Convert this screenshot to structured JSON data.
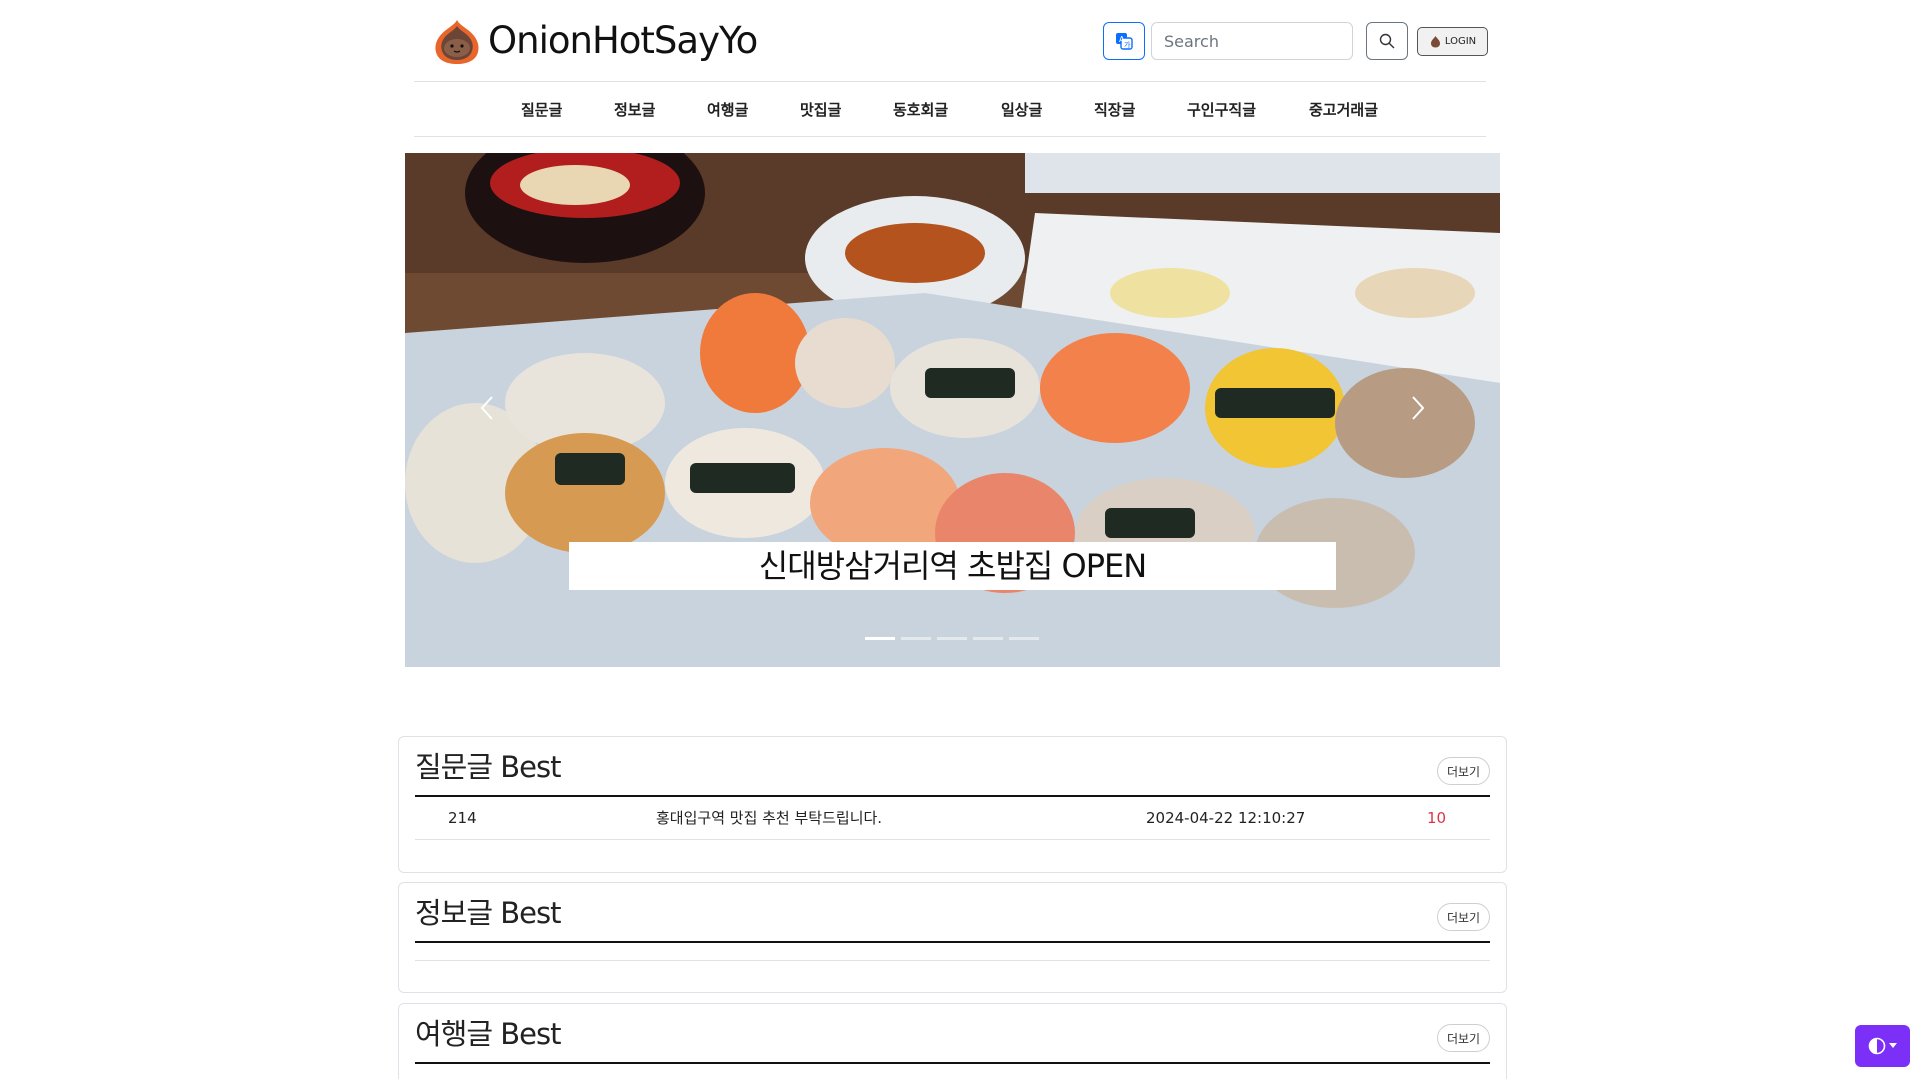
{
  "header": {
    "logo_text": "OnionHotSayYo",
    "search_placeholder": "Search",
    "login_label": "LOGIN"
  },
  "nav": {
    "items": [
      "질문글",
      "정보글",
      "여행글",
      "맛집글",
      "동호회글",
      "일상글",
      "직장글",
      "구인구직글",
      "중고거래글"
    ]
  },
  "carousel": {
    "caption": "신대방삼거리역 초밥집 OPEN",
    "slide_count": 5,
    "active_index": 0
  },
  "sections": [
    {
      "title": "질문글 Best",
      "more_label": "더보기",
      "rows": [
        {
          "id": "214",
          "subject": "홍대입구역 맛집 추천 부탁드립니다.",
          "date": "2024-04-22 12:10:27",
          "count": "10"
        }
      ]
    },
    {
      "title": "정보글 Best",
      "more_label": "더보기",
      "rows": []
    },
    {
      "title": "여행글 Best",
      "more_label": "더보기",
      "rows": []
    }
  ],
  "colors": {
    "primary": "#0d6efd",
    "theme_toggle": "#7b2ff7",
    "count_red": "#dc3545"
  },
  "icons": {
    "logo": "onion-logo-icon",
    "translate": "translate-icon",
    "search": "search-icon",
    "login": "onion-icon",
    "prev": "chevron-left-icon",
    "next": "chevron-right-icon",
    "theme": "half-circle-icon"
  }
}
